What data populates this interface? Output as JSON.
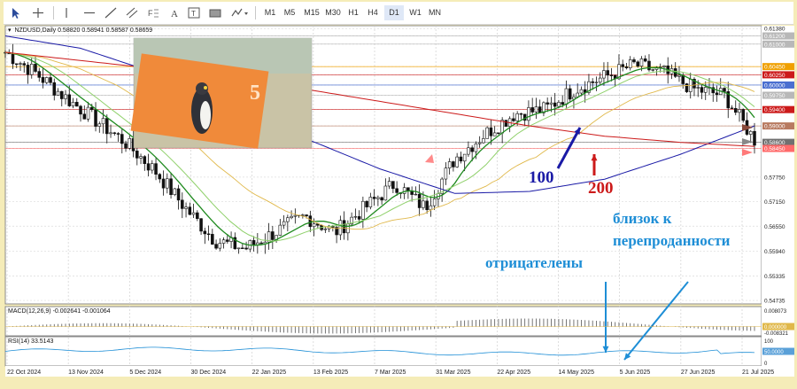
{
  "toolbar": {
    "timeframes": [
      "M1",
      "M5",
      "M15",
      "M30",
      "H1",
      "H4",
      "D1",
      "W1",
      "MN"
    ],
    "active_timeframe": "D1"
  },
  "header": {
    "symbol": "NZDUSD,Daily",
    "ohlc": "0.58820 0.58941 0.58587 0.58659"
  },
  "macd": {
    "label": "MACD(12,26,9) -0.002641 -0.001064",
    "scale_top": "0.008073",
    "scale_zero": "0.000000",
    "scale_bottom": "-0.008321"
  },
  "rsi": {
    "label": "RSI(14) 33.5143",
    "scale_top": "100",
    "scale_mid": "50.0000",
    "scale_bottom": "0"
  },
  "annotations": {
    "ma100": "100",
    "ma200": "200",
    "near_oversold": "близок к перепроданности",
    "negative": "отрицателены"
  },
  "colors": {
    "ma100": "#1a1aa6",
    "ma200": "#cc1a1a",
    "annotation_blue": "#1e8ed6",
    "candles": "#111111",
    "green_ma": "#1f8a1f",
    "light_green_ma": "#8fd06a",
    "yellow_ma": "#e0b84a"
  },
  "chart_data": {
    "type": "line",
    "title": "NZDUSD,Daily",
    "date_labels": [
      "22 Oct 2024",
      "13 Nov 2024",
      "5 Dec 2024",
      "30 Dec 2024",
      "22 Jan 2025",
      "13 Feb 2025",
      "7 Mar 2025",
      "31 Mar 2025",
      "22 Apr 2025",
      "14 May 2025",
      "5 Jun 2025",
      "27 Jun 2025",
      "21 Jul 2025"
    ],
    "y_ticks": [
      0.6138,
      0.612,
      0.61,
      0.6045,
      0.6025,
      0.6,
      0.5975,
      0.594,
      0.59,
      0.586,
      0.5845,
      0.5775,
      0.5715,
      0.5655,
      0.5594,
      0.55335,
      0.54735
    ],
    "ylim": [
      0.5465,
      0.6145
    ],
    "highlighted_levels": [
      {
        "value": 0.612,
        "color": "#b8b8b8"
      },
      {
        "value": 0.61,
        "color": "#b8b8b8"
      },
      {
        "value": 0.6045,
        "color": "#f0a000"
      },
      {
        "value": 0.6025,
        "color": "#cc1a1a"
      },
      {
        "value": 0.6,
        "color": "#4a6fd0"
      },
      {
        "value": 0.5975,
        "color": "#b8b8b8"
      },
      {
        "value": 0.594,
        "color": "#cc1a1a"
      },
      {
        "value": 0.59,
        "color": "#b87a60"
      },
      {
        "value": 0.586,
        "color": "#707070"
      },
      {
        "value": 0.5845,
        "color": "#ff6a6a"
      }
    ],
    "series": [
      {
        "x": [
          0,
          0.04,
          0.08,
          0.12,
          0.16,
          0.2,
          0.24,
          0.28,
          0.32,
          0.36,
          0.4,
          0.44,
          0.48,
          0.52,
          0.56,
          0.6,
          0.64,
          0.68,
          0.72,
          0.76,
          0.8,
          0.84,
          0.88,
          0.92,
          0.96,
          1.0
        ],
        "values": [
          0.608,
          0.603,
          0.597,
          0.5915,
          0.586,
          0.579,
          0.57,
          0.562,
          0.56,
          0.564,
          0.568,
          0.564,
          0.57,
          0.576,
          0.57,
          0.582,
          0.588,
          0.593,
          0.594,
          0.599,
          0.602,
          0.605,
          0.603,
          0.599,
          0.5975,
          0.5866
        ]
      },
      {
        "x": [
          0,
          0.1,
          0.2,
          0.3,
          0.4,
          0.5,
          0.6,
          0.7,
          0.8,
          0.9,
          1.0
        ],
        "values": [
          0.612,
          0.609,
          0.603,
          0.595,
          0.587,
          0.5795,
          0.5735,
          0.574,
          0.577,
          0.583,
          0.59
        ]
      },
      {
        "x": [
          0,
          0.1,
          0.2,
          0.3,
          0.4,
          0.5,
          0.6,
          0.7,
          0.8,
          0.9,
          1.0
        ],
        "values": [
          0.608,
          0.606,
          0.604,
          0.6015,
          0.599,
          0.596,
          0.593,
          0.59,
          0.5875,
          0.586,
          0.585
        ]
      }
    ]
  }
}
